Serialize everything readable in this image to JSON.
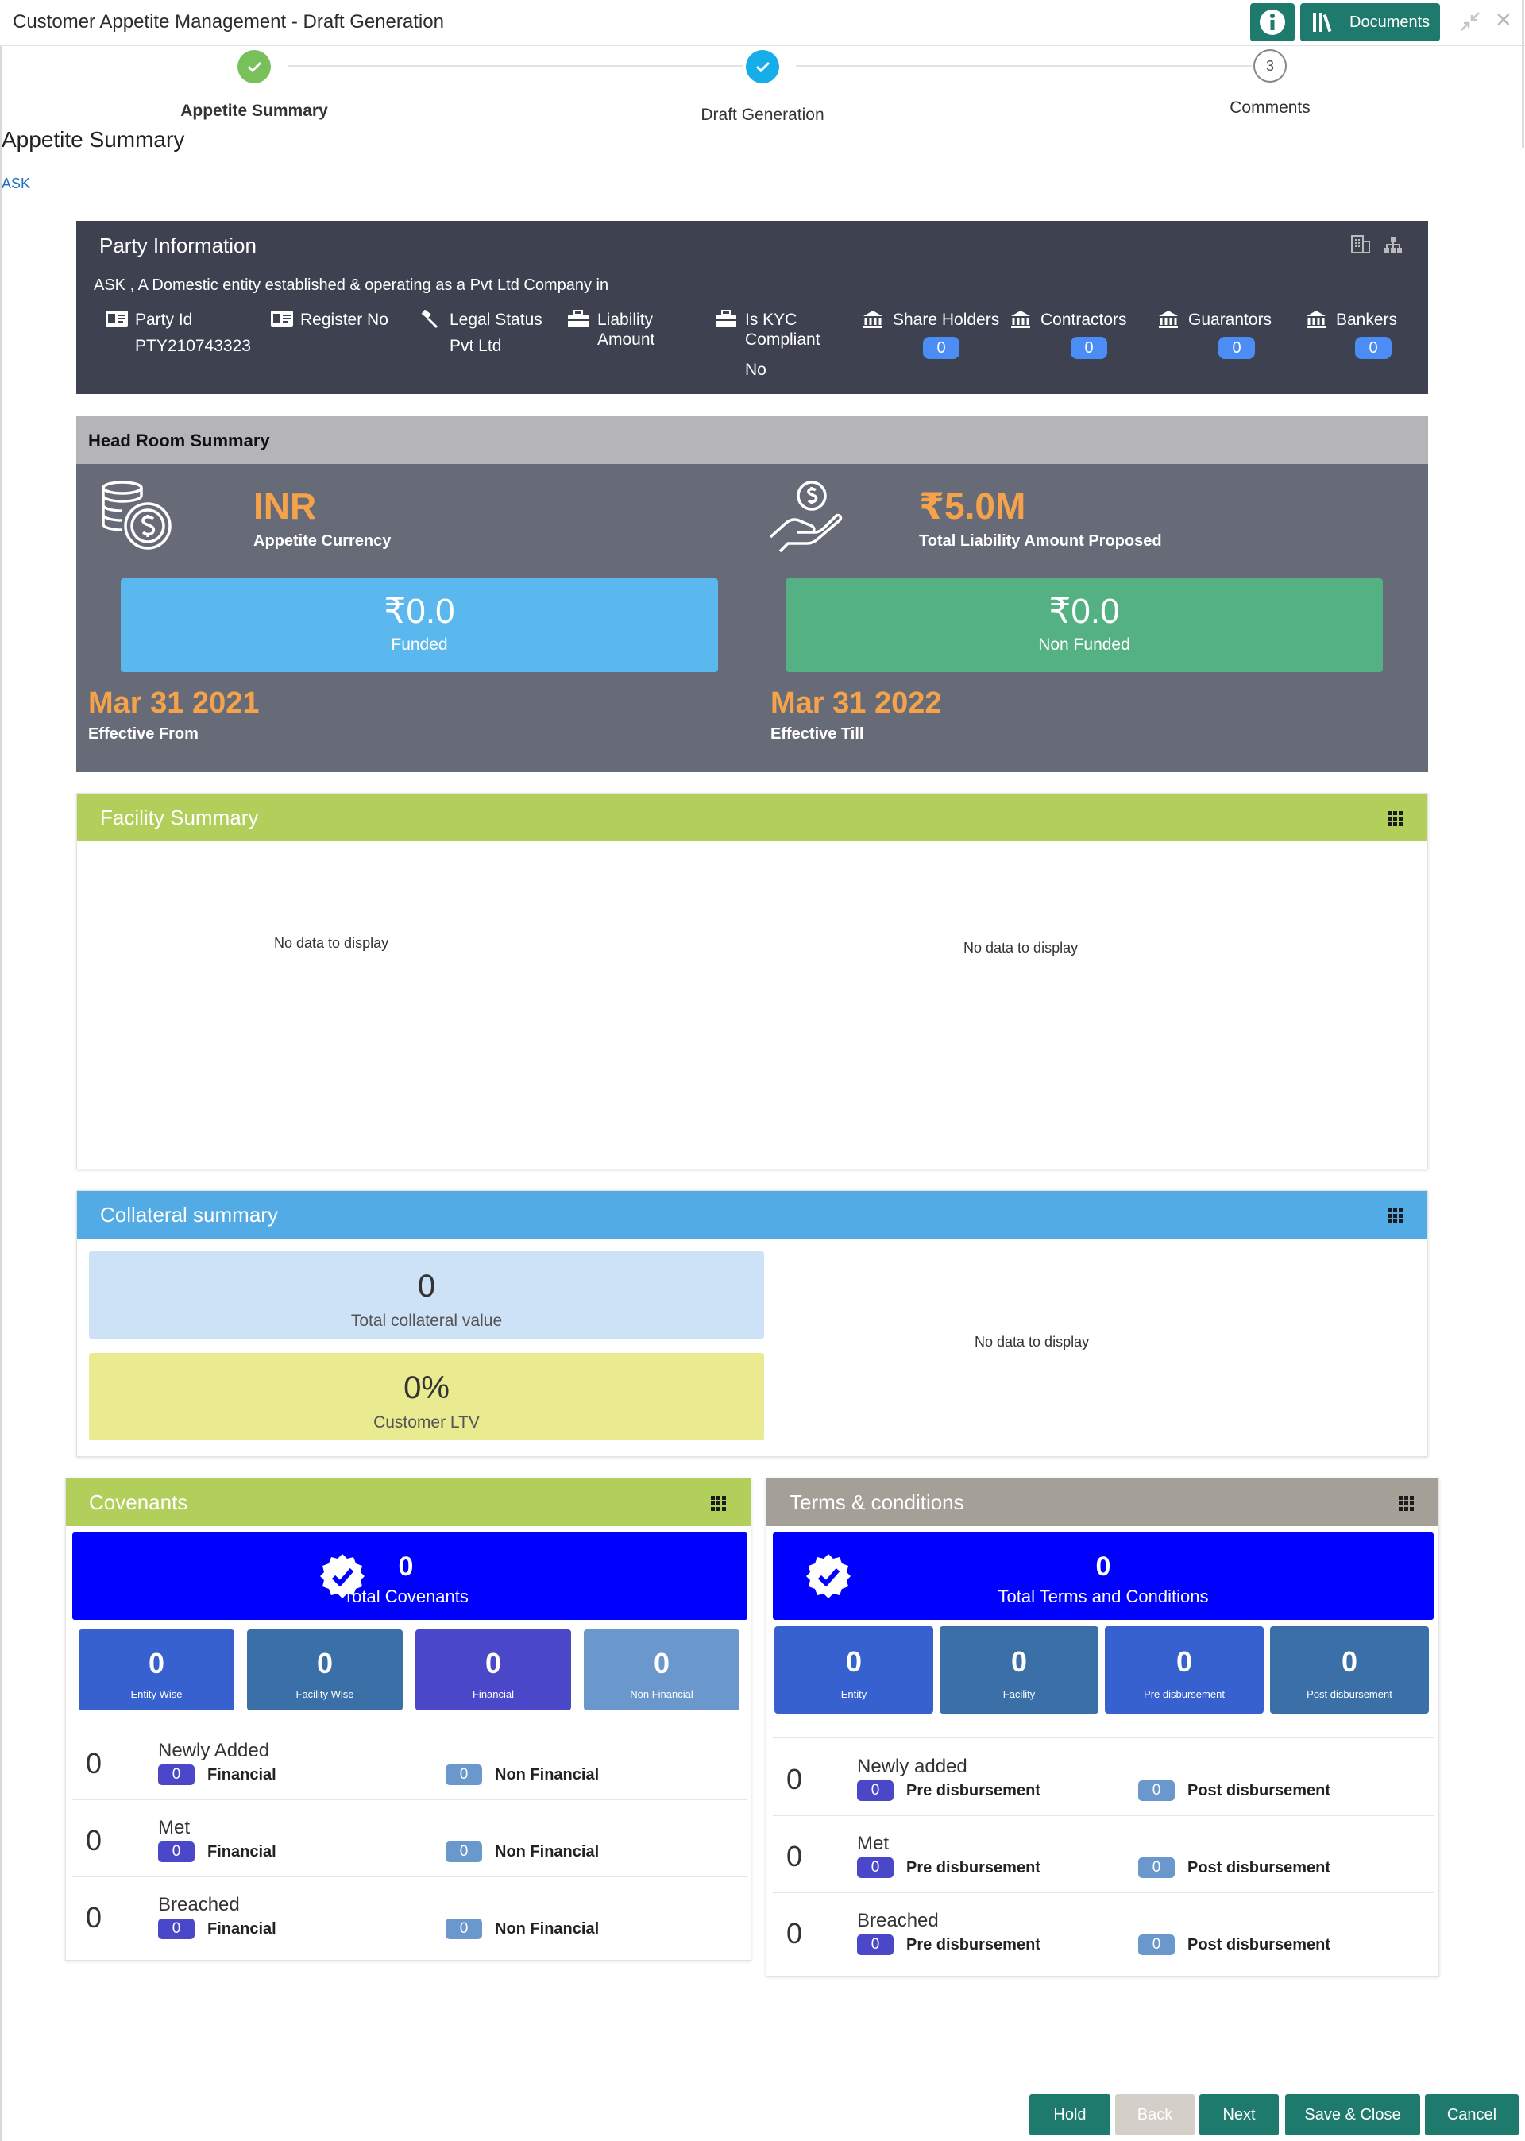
{
  "window": {
    "title": "Customer Appetite Management - Draft Generation",
    "docs_label": "Documents"
  },
  "stepper": {
    "steps": [
      {
        "label": "Appetite Summary",
        "state": "complete"
      },
      {
        "label": "Draft Generation",
        "state": "current"
      },
      {
        "label": "Comments",
        "state": "pending",
        "number": "3"
      }
    ]
  },
  "section": {
    "title": "Appetite Summary",
    "party_link": "ASK"
  },
  "party_info": {
    "title": "Party Information",
    "description": "ASK , A Domestic entity established & operating as a Pvt Ltd Company in",
    "fields": {
      "party_id_label": "Party Id",
      "party_id_value": "PTY210743323",
      "register_no_label": "Register No",
      "legal_status_label": "Legal Status",
      "legal_status_value": "Pvt Ltd",
      "liability_label_1": "Liability",
      "liability_label_2": "Amount",
      "kyc_label_1": "Is KYC",
      "kyc_label_2": "Compliant",
      "kyc_value": "No"
    },
    "counts": {
      "share_holders_label": "Share Holders",
      "share_holders": "0",
      "contractors_label": "Contractors",
      "contractors": "0",
      "guarantors_label": "Guarantors",
      "guarantors": "0",
      "bankers_label": "Bankers",
      "bankers": "0"
    }
  },
  "headroom": {
    "title": "Head Room Summary",
    "currency": "INR",
    "currency_label": "Appetite Currency",
    "total_liability": "₹5.0M",
    "total_liability_label": "Total Liability Amount Proposed",
    "funded": "₹0.0",
    "funded_label": "Funded",
    "non_funded": "₹0.0",
    "non_funded_label": "Non Funded",
    "effective_from": "Mar 31 2021",
    "effective_from_label": "Effective From",
    "effective_till": "Mar 31 2022",
    "effective_till_label": "Effective Till"
  },
  "facility": {
    "title": "Facility Summary",
    "nodata_left": "No data to display",
    "nodata_right": "No data to display"
  },
  "collateral": {
    "title": "Collateral summary",
    "total_value": "0",
    "total_value_label": "Total collateral value",
    "ltv": "0%",
    "ltv_label": "Customer LTV",
    "nodata": "No data to display"
  },
  "covenants": {
    "title": "Covenants",
    "total": "0",
    "total_label": "Total Covenants",
    "tiles": [
      {
        "value": "0",
        "label": "Entity Wise"
      },
      {
        "value": "0",
        "label": "Facility Wise"
      },
      {
        "value": "0",
        "label": "Financial"
      },
      {
        "value": "0",
        "label": "Non Financial"
      }
    ],
    "rows": [
      {
        "count": "0",
        "title": "Newly Added",
        "a_count": "0",
        "a_label": "Financial",
        "b_count": "0",
        "b_label": "Non Financial"
      },
      {
        "count": "0",
        "title": "Met",
        "a_count": "0",
        "a_label": "Financial",
        "b_count": "0",
        "b_label": "Non Financial"
      },
      {
        "count": "0",
        "title": "Breached",
        "a_count": "0",
        "a_label": "Financial",
        "b_count": "0",
        "b_label": "Non Financial"
      }
    ]
  },
  "terms": {
    "title": "Terms & conditions",
    "total": "0",
    "total_label": "Total Terms and Conditions",
    "tiles": [
      {
        "value": "0",
        "label": "Entity"
      },
      {
        "value": "0",
        "label": "Facility"
      },
      {
        "value": "0",
        "label": "Pre disbursement"
      },
      {
        "value": "0",
        "label": "Post disbursement"
      }
    ],
    "rows": [
      {
        "count": "0",
        "title": "Newly added",
        "a_count": "0",
        "a_label": "Pre disbursement",
        "b_count": "0",
        "b_label": "Post disbursement"
      },
      {
        "count": "0",
        "title": "Met",
        "a_count": "0",
        "a_label": "Pre disbursement",
        "b_count": "0",
        "b_label": "Post disbursement"
      },
      {
        "count": "0",
        "title": "Breached",
        "a_count": "0",
        "a_label": "Pre disbursement",
        "b_count": "0",
        "b_label": "Post disbursement"
      }
    ]
  },
  "footer": {
    "hold": "Hold",
    "back": "Back",
    "next": "Next",
    "save_close": "Save & Close",
    "cancel": "Cancel"
  },
  "colors": {
    "teal": "#1f7a6e",
    "orange": "#f5a34a",
    "green_header": "#b3cf5b",
    "blue_header": "#52abe4",
    "grey_header": "#a4a098"
  }
}
